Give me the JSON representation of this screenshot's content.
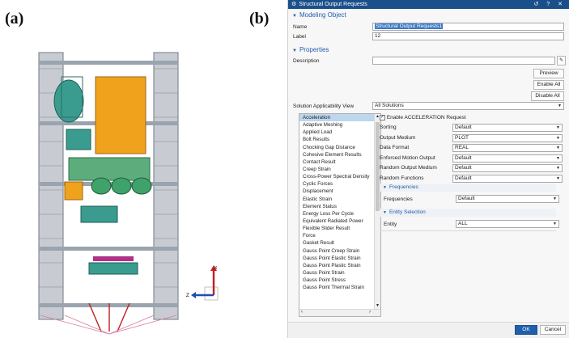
{
  "figure_labels": {
    "a": "(a)",
    "b": "(b)"
  },
  "dialog": {
    "title": "Structural Output Requests",
    "title_icons": [
      "refresh-icon",
      "help-icon",
      "close-icon"
    ],
    "title_icon_glyphs": "↺ ? ✕",
    "modeling_object": {
      "header": "Modeling Object",
      "name_label": "Name",
      "name_value": "Structural Output Requests1",
      "label_label": "Label",
      "label_value": "12"
    },
    "properties": {
      "header": "Properties",
      "description_label": "Description",
      "description_value": "",
      "preview_button": "Preview",
      "enable_all_button": "Enable All",
      "disable_all_button": "Disable All",
      "solution_label": "Solution Applicability View",
      "solution_value": "All Solutions"
    },
    "request_list": [
      "Acceleration",
      "Adaptive Meshing",
      "Applied Load",
      "Bolt Results",
      "Chocking Gap Distance",
      "Cohesive Element Results",
      "Contact Result",
      "Creep Strain",
      "Cross-Power Spectral Density",
      "Cyclic Forces",
      "Displacement",
      "Elastic Strain",
      "Element Status",
      "Energy Loss Per Cycle",
      "Equivalent Radiated Power",
      "Flexible Slider Result",
      "Force",
      "Gasket Result",
      "Gauss Point Creep Strain",
      "Gauss Point Elastic Strain",
      "Gauss Point Plastic Strain",
      "Gauss Point Strain",
      "Gauss Point Stress",
      "Gauss Point Thermal Strain"
    ],
    "selected_item": "Acceleration",
    "enable_checkbox_label": "Enable ACCELERATION Request",
    "enable_checked": true,
    "settings": [
      {
        "label": "Sorting",
        "value": "Default"
      },
      {
        "label": "Output Medium",
        "value": "PLOT"
      },
      {
        "label": "Data Format",
        "value": "REAL"
      },
      {
        "label": "Enforced Motion Output",
        "value": "Default"
      },
      {
        "label": "Random Output Medium",
        "value": "Default"
      },
      {
        "label": "Random Functions",
        "value": "Default"
      }
    ],
    "frequencies": {
      "header": "Frequencies",
      "label": "Frequencies",
      "value": "Default"
    },
    "entity_selection": {
      "header": "Entity Selection",
      "label": "Entity",
      "value": "ALL"
    },
    "ok_button": "OK",
    "cancel_button": "Cancel"
  },
  "triad": {
    "z_label": "Z",
    "x_label": "X"
  },
  "colors": {
    "titlebar": "#1a4f8a",
    "accent": "#1f5fae",
    "selection": "#bcd7ee",
    "model_orange": "#f0a21c",
    "model_teal": "#3a9c8e"
  }
}
